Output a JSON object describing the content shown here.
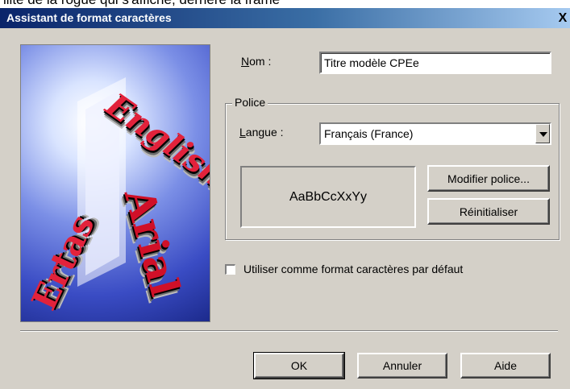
{
  "background_text": "ilite de la rogue qui s'affiche, derrière la frame",
  "window": {
    "title": "Assistant de format caractères",
    "close_glyph": "X"
  },
  "art": {
    "words": [
      "English",
      "Arial",
      "Ertas"
    ]
  },
  "form": {
    "name_label": "Nom :",
    "name_value": "Titre modèle CPEe",
    "group_label": "Police",
    "language_label": "Langue :",
    "language_value": "Français (France)",
    "preview_text": "AaBbCcXxYy",
    "modify_font_label": "Modifier police...",
    "reset_label": "Réinitialiser",
    "default_checkbox_label": "Utiliser comme format caractères par défaut",
    "default_checked": false
  },
  "buttons": {
    "ok": "OK",
    "cancel": "Annuler",
    "help": "Aide"
  },
  "colors": {
    "face": "#d4d0c8",
    "title_active": "#0a246a",
    "art_red": "#c8102e"
  }
}
